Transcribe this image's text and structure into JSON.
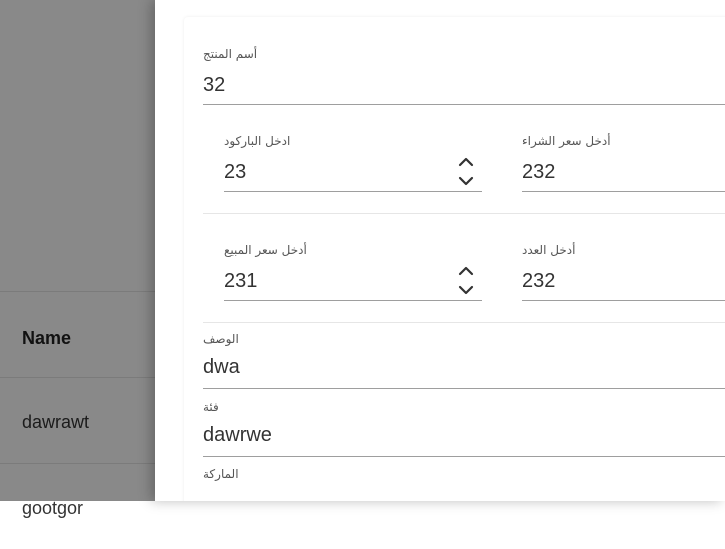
{
  "background_table": {
    "header": "Name",
    "rows": [
      "dawrawt",
      "gootgor"
    ]
  },
  "form": {
    "product_name": {
      "label": "أسم المنتج",
      "value": "32"
    },
    "barcode": {
      "label": "ادخل الباركود",
      "value": "23"
    },
    "purchase_price": {
      "label": "أدخل سعر الشراء",
      "value": "232"
    },
    "sale_price": {
      "label": "أدخل سعر المبيع",
      "value": "231"
    },
    "quantity": {
      "label": "أدخل العدد",
      "value": "232"
    },
    "description": {
      "label": "الوصف",
      "value": "dwa"
    },
    "category": {
      "label": "فئة",
      "value": "dawrwe"
    },
    "brand": {
      "label": "الماركة",
      "value": ""
    }
  },
  "icons": {
    "spinner_up": "chevron-up-icon",
    "spinner_down": "chevron-down-icon"
  },
  "colors": {
    "overlay": "#000000",
    "underline": "#9e9e9e"
  }
}
